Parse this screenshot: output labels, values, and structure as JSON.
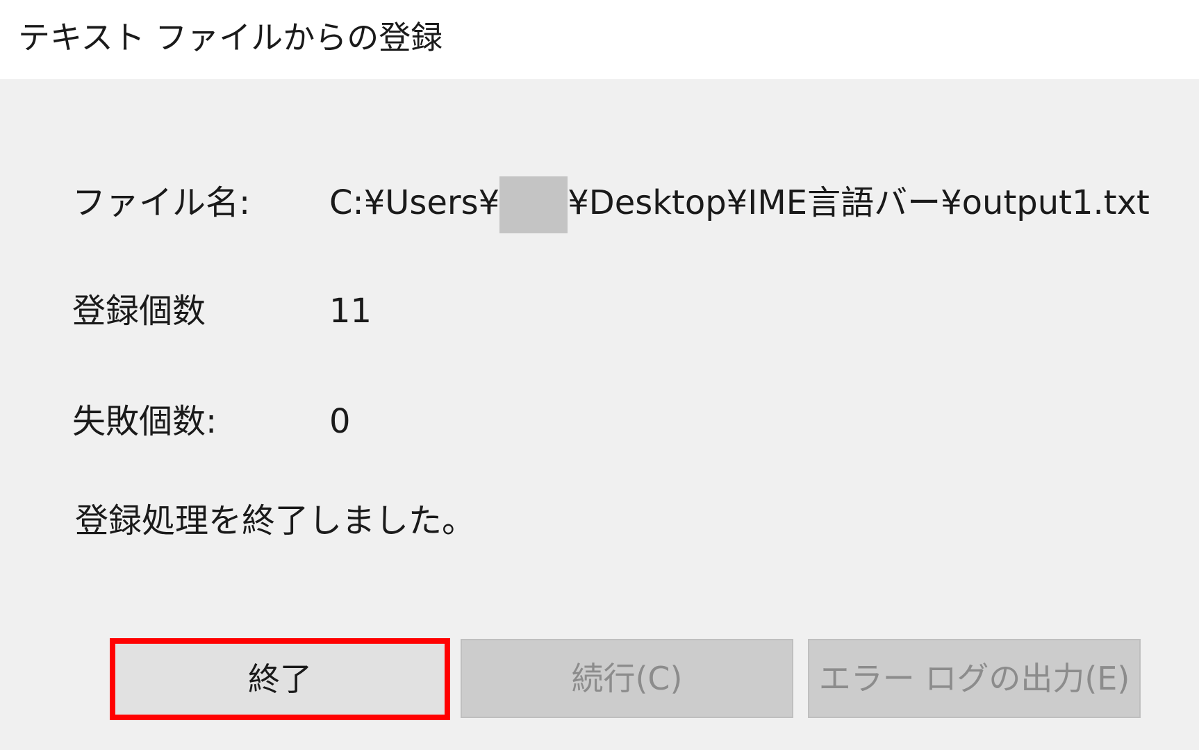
{
  "window": {
    "title": "テキスト ファイルからの登録"
  },
  "fields": {
    "filename_label": "ファイル名:",
    "filename_prefix": "C:¥Users¥",
    "filename_suffix": "¥Desktop¥IME言語バー¥output1.txt",
    "registered_label": "登録個数",
    "registered_value": "11",
    "failed_label": "失敗個数:",
    "failed_value": "0"
  },
  "message": "登録処理を終了しました。",
  "buttons": {
    "finish": "終了",
    "continue": "続行(C)",
    "error_log": "エラー ログの出力(E)"
  },
  "colors": {
    "highlight": "#ff0000",
    "body_background": "#f0f0f0",
    "disabled_text": "#8c8c8c"
  }
}
